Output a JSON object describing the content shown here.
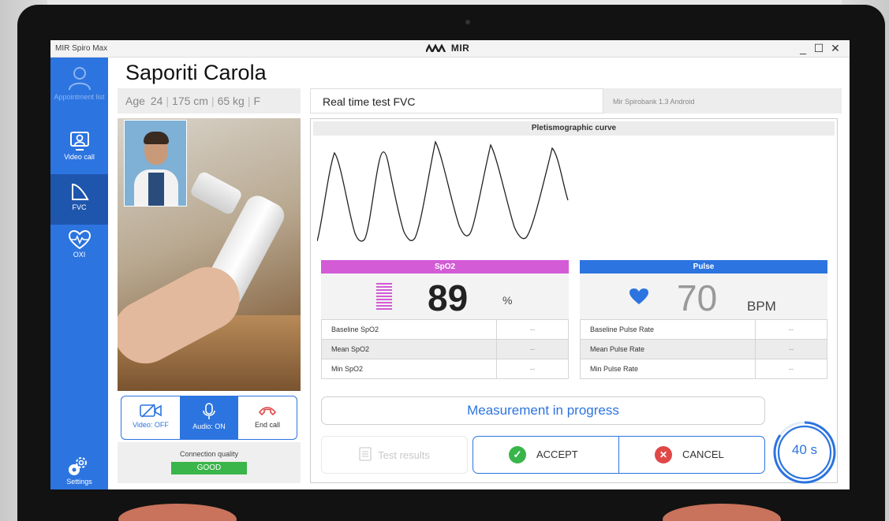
{
  "window": {
    "app_name": "MIR Spiro Max",
    "brand": "MIR",
    "minimize": "_",
    "maximize": "☐",
    "close": "✕"
  },
  "sidebar": {
    "items": [
      {
        "label": "Appointment list",
        "icon": "user-icon"
      },
      {
        "label": "Video call",
        "icon": "video-call-icon"
      },
      {
        "label": "FVC",
        "icon": "spirometry-curve-icon"
      },
      {
        "label": "OXI",
        "icon": "heart-pulse-icon"
      },
      {
        "label": "Settings",
        "icon": "gear-icon"
      }
    ]
  },
  "patient": {
    "name": "Saporiti Carola",
    "age_label": "Age",
    "age": "24",
    "height": "175 cm",
    "weight": "65 kg",
    "sex": "F"
  },
  "test": {
    "title": "Real time test FVC",
    "device": "Mir Spirobank 1.3 Android"
  },
  "call": {
    "video_label": "Video: OFF",
    "audio_label": "Audio: ON",
    "end_label": "End call",
    "connection_label": "Connection quality",
    "connection_status": "GOOD"
  },
  "curve": {
    "title": "Pletismographic curve"
  },
  "spo2": {
    "header": "SpO2",
    "value": "89",
    "unit": "%",
    "rows": [
      {
        "label": "Baseline SpO2",
        "value": "--"
      },
      {
        "label": "Mean SpO2",
        "value": "--"
      },
      {
        "label": "Min SpO2",
        "value": "--"
      }
    ]
  },
  "pulse": {
    "header": "Pulse",
    "value": "70",
    "unit": "BPM",
    "rows": [
      {
        "label": "Baseline Pulse Rate",
        "value": "--"
      },
      {
        "label": "Mean Pulse Rate",
        "value": "--"
      },
      {
        "label": "Min Pulse Rate",
        "value": "--"
      }
    ]
  },
  "status": {
    "message": "Measurement in progress"
  },
  "actions": {
    "test_results": "Test results",
    "accept": "ACCEPT",
    "cancel": "CANCEL"
  },
  "timer": {
    "label": "40 s"
  },
  "colors": {
    "sidebar": "#2c74e0",
    "sidebar_active": "#1f56ad",
    "spo2_header": "#d35bd6",
    "pulse_header": "#2c74e0",
    "accept": "#39b54a",
    "cancel": "#e04848",
    "connection_good": "#39b54a"
  }
}
